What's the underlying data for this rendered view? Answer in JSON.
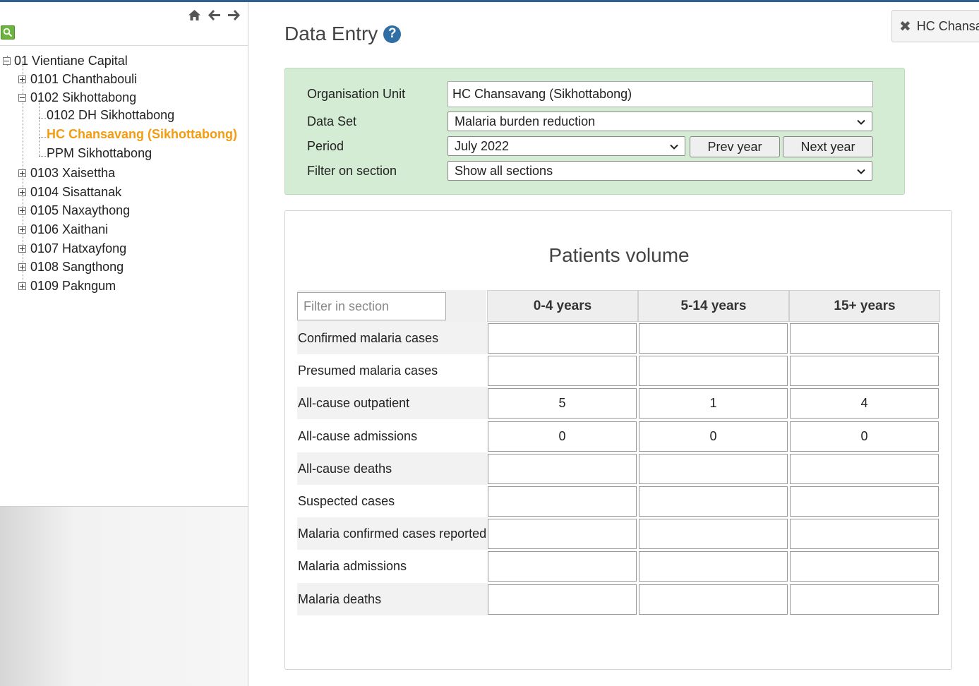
{
  "sidebar": {
    "tree": [
      {
        "label": "01 Vientiane Capital",
        "level": 0,
        "toggle": "minus"
      },
      {
        "label": "0101 Chanthabouli",
        "level": 1,
        "toggle": "plus"
      },
      {
        "label": "0102 Sikhottabong",
        "level": 1,
        "toggle": "minus"
      },
      {
        "label": "0102 DH Sikhottabong",
        "level": 2,
        "toggle": "none"
      },
      {
        "label": "HC Chansavang (Sikhottabong)",
        "level": 2,
        "toggle": "none",
        "selected": true
      },
      {
        "label": "PPM Sikhottabong",
        "level": 2,
        "toggle": "none"
      },
      {
        "label": "0103 Xaisettha",
        "level": 1,
        "toggle": "plus"
      },
      {
        "label": "0104 Sisattanak",
        "level": 1,
        "toggle": "plus"
      },
      {
        "label": "0105 Naxaythong",
        "level": 1,
        "toggle": "plus"
      },
      {
        "label": "0106 Xaithani",
        "level": 1,
        "toggle": "plus"
      },
      {
        "label": "0107 Hatxayfong",
        "level": 1,
        "toggle": "plus"
      },
      {
        "label": "0108 Sangthong",
        "level": 1,
        "toggle": "plus"
      },
      {
        "label": "0109 Pakngum",
        "level": 1,
        "toggle": "plus"
      }
    ],
    "icons": [
      "home-icon",
      "arrow-left-icon",
      "arrow-right-icon",
      "search-icon"
    ]
  },
  "header": {
    "title": "Data Entry",
    "help_glyph": "?",
    "close_tab_label": "HC Chansavang (Sikhottabong)",
    "close_glyph": "✖"
  },
  "selection": {
    "org_unit_label": "Organisation Unit",
    "org_unit_value": "HC Chansavang (Sikhottabong)",
    "data_set_label": "Data Set",
    "data_set_value": "Malaria burden reduction",
    "period_label": "Period",
    "period_value": "July 2022",
    "prev_year": "Prev year",
    "next_year": "Next year",
    "filter_label": "Filter on section",
    "filter_value": "Show all sections"
  },
  "form": {
    "section_title": "Patients volume",
    "filter_placeholder": "Filter in section",
    "columns": [
      "0-4 years",
      "5-14 years",
      "15+ years"
    ],
    "rows": [
      {
        "label": "Confirmed malaria cases",
        "values": [
          "",
          "",
          ""
        ]
      },
      {
        "label": "Presumed malaria cases",
        "values": [
          "",
          "",
          ""
        ]
      },
      {
        "label": "All-cause outpatient",
        "values": [
          "5",
          "1",
          "4"
        ]
      },
      {
        "label": "All-cause admissions",
        "values": [
          "0",
          "0",
          "0"
        ]
      },
      {
        "label": "All-cause deaths",
        "values": [
          "",
          "",
          ""
        ]
      },
      {
        "label": "Suspected cases",
        "values": [
          "",
          "",
          ""
        ]
      },
      {
        "label": "Malaria confirmed cases reported",
        "values": [
          "",
          "",
          ""
        ]
      },
      {
        "label": "Malaria admissions",
        "values": [
          "",
          "",
          ""
        ]
      },
      {
        "label": "Malaria deaths",
        "values": [
          "",
          "",
          ""
        ]
      }
    ]
  },
  "colors": {
    "selected": "#f39c12",
    "selection_bg": "#d3ecd3",
    "help_icon": "#2f6fa6",
    "search_button": "#6db33f"
  }
}
